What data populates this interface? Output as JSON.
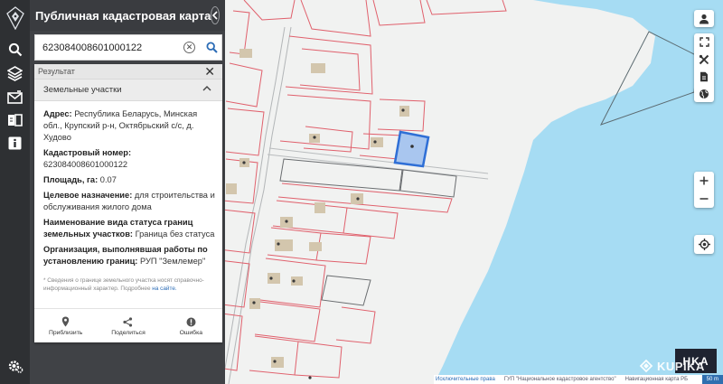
{
  "header": {
    "title": "Публичная кадастровая карта"
  },
  "search": {
    "value": "623084008601000122"
  },
  "result": {
    "heading": "Результат",
    "section_label": "Земельные участки",
    "properties": [
      {
        "label": "Адрес:",
        "value": " Республика Беларусь, Минская обл., Крупский р-н, Октябрьский с/с, д. Худово"
      },
      {
        "label": "Кадастровый номер:",
        "value": " 623084008601000122"
      },
      {
        "label": "Площадь, га:",
        "value": " 0.07"
      },
      {
        "label": "Целевое назначение:",
        "value": " для строительства и обслуживания жилого дома"
      },
      {
        "label": "Наименование вида статуса границ земельных участков:",
        "value": " Граница без статуса"
      },
      {
        "label": "Организация, выполнявшая работы по установлению границ:",
        "value": " РУП \"Землемер\""
      }
    ],
    "note_text": "* Сведения о границе земельного участка носят справочно-информационный характер. Подробнее",
    "note_link": "на сайте.",
    "actions": {
      "zoom": "Приблизить",
      "share": "Поделиться",
      "error": "Ошибка"
    }
  },
  "bottom_bar": {
    "link1": "Исключительные права",
    "link2": "ГУП \"Национальное кадастровое агентство\"",
    "link3": "Навигационная карта РБ",
    "scale": "50 m"
  },
  "watermark": {
    "brand": "KUPIKA",
    "tile": "HKA"
  },
  "icons": {
    "rail": [
      "logo-icon",
      "search-icon",
      "layers-icon",
      "mail-icon",
      "book-icon",
      "info-icon",
      "settings-icon"
    ],
    "tools": [
      "user-icon",
      "fullscreen-icon",
      "measure-icon",
      "document-icon",
      "globe-icon",
      "zoom-in-icon",
      "zoom-out-icon",
      "locate-icon"
    ]
  },
  "colors": {
    "water": "#a6dcf3",
    "parcel_border": "#e0606c",
    "selected_fill": "#a9c6ef",
    "selected_border": "#2f6fd6",
    "panel_bg": "#404246",
    "rail_bg": "#2e3033"
  }
}
